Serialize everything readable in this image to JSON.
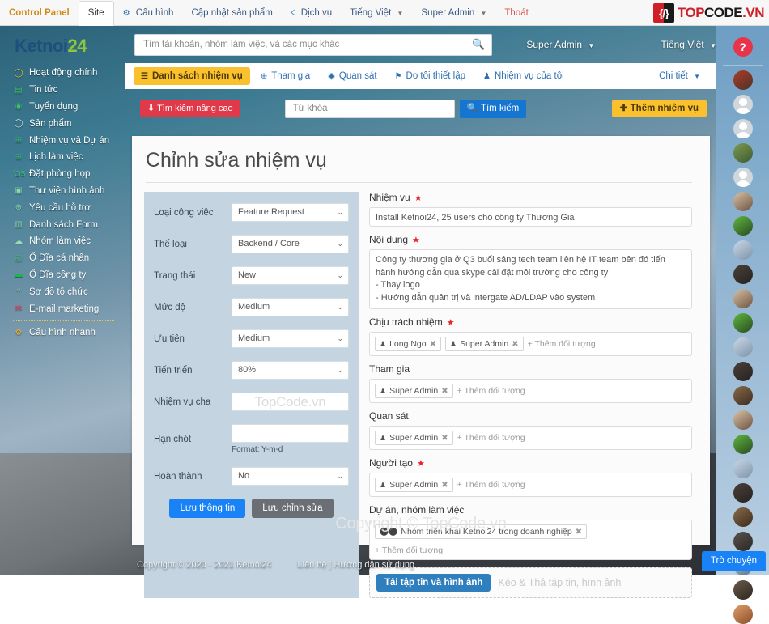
{
  "topbar": {
    "items": [
      {
        "label": "Control Panel",
        "style": "cp",
        "icon": null
      },
      {
        "label": "Site",
        "style": "site",
        "icon": null
      },
      {
        "label": "Cấu hình",
        "style": "nav",
        "icon": "gear-icon"
      },
      {
        "label": "Cập nhật sản phẩm",
        "style": "nav",
        "icon": null
      },
      {
        "label": "Dịch vụ",
        "style": "nav",
        "icon": "support-icon"
      },
      {
        "label": "Tiếng Việt",
        "style": "nav",
        "icon": null,
        "caret": true
      },
      {
        "label": "Super Admin",
        "style": "nav",
        "icon": null,
        "caret": true
      },
      {
        "label": "Thoát",
        "style": "exit",
        "icon": null
      }
    ],
    "logo": {
      "part1": "TOP",
      "part2": "CODE",
      "part3": ".VN",
      "glyph": "{/}"
    }
  },
  "sidebar": {
    "brand_1": "Ketnoi",
    "brand_2": "24",
    "items": [
      {
        "label": "Hoạt động chính",
        "icon": "circle-icon",
        "color": "#f0c419"
      },
      {
        "label": "Tin tức",
        "icon": "news-icon",
        "color": "#3fbf6f"
      },
      {
        "label": "Tuyển dụng",
        "icon": "user-circle-icon",
        "color": "#3fbf6f"
      },
      {
        "label": "Sản phẩm",
        "icon": "circle-icon",
        "color": "#cfe8d8"
      },
      {
        "label": "Nhiệm vụ và Dự án",
        "icon": "grid-icon",
        "color": "#3fbf6f"
      },
      {
        "label": "Lịch làm việc",
        "icon": "grid-icon",
        "color": "#3fbf6f"
      },
      {
        "label": "Đặt phòng họp",
        "icon": "calendar-icon",
        "color": "#3fbf6f"
      },
      {
        "label": "Thư viện hình ảnh",
        "icon": "image-icon",
        "color": "#8fd9ab"
      },
      {
        "label": "Yêu cầu hỗ trợ",
        "icon": "lifebuoy-icon",
        "color": "#8fd9ab"
      },
      {
        "label": "Danh sách Form",
        "icon": "form-icon",
        "color": "#8fd9ab"
      },
      {
        "label": "Nhóm làm việc",
        "icon": "group-icon",
        "color": "#9ed9b5"
      },
      {
        "label": "Ổ Đĩa cá nhân",
        "icon": "folder-open-icon",
        "color": "#3fbf6f"
      },
      {
        "label": "Ổ Đĩa công ty",
        "icon": "folder-icon",
        "color": "#1eb54a"
      },
      {
        "label": "Sơ đồ tổ chức",
        "icon": "sitemap-icon",
        "color": "#8fd9ab"
      },
      {
        "label": "E-mail marketing",
        "icon": "envelope-icon",
        "color": "#e8424f"
      }
    ],
    "footer_item": {
      "label": "Cấu hình nhanh",
      "icon": "gear-icon",
      "color": "#f0b429"
    }
  },
  "header": {
    "search_placeholder": "Tìm tài khoản, nhóm làm việc, và các mục khác",
    "search_value": "",
    "search_icon": "search-icon",
    "user": "Super Admin",
    "language": "Tiếng Việt"
  },
  "tabs": {
    "items": [
      {
        "label": "Danh sách nhiệm vụ",
        "icon": "list-icon",
        "active": true
      },
      {
        "label": "Tham gia",
        "icon": "plus-circle-icon",
        "active": false
      },
      {
        "label": "Quan sát",
        "icon": "eye-icon",
        "active": false
      },
      {
        "label": "Do tôi thiết lập",
        "icon": "pin-icon",
        "active": false
      },
      {
        "label": "Nhiệm vụ của tôi",
        "icon": "person-icon",
        "active": false
      }
    ],
    "detail": "Chi tiết"
  },
  "filter": {
    "advanced_label": "Tìm kiếm nâng cao",
    "advanced_icon": "arrow-down-icon",
    "keyword_placeholder": "Từ khóa",
    "keyword_value": "",
    "search_label": "Tìm kiếm",
    "search_icon": "search-icon",
    "add_label": "Thêm nhiệm vụ",
    "add_icon": "plus-icon"
  },
  "card": {
    "title": "Chỉnh sửa nhiệm vụ",
    "watermark": "Copyright © TopCode.vn",
    "left_form": {
      "rows": [
        {
          "label": "Loại công việc",
          "type": "select",
          "value": "Feature Request"
        },
        {
          "label": "Thể loại",
          "type": "select",
          "value": "Backend / Core"
        },
        {
          "label": "Trang thái",
          "type": "select",
          "value": "New"
        },
        {
          "label": "Mức độ",
          "type": "select",
          "value": "Medium"
        },
        {
          "label": "Ưu tiên",
          "type": "select",
          "value": "Medium"
        },
        {
          "label": "Tiến triển",
          "type": "select",
          "value": "80%"
        },
        {
          "label": "Nhiệm vụ cha",
          "type": "watermark",
          "value": "TopCode.vn"
        },
        {
          "label": "Hạn chót",
          "type": "text",
          "value": "",
          "hint": "Format: Y-m-d"
        },
        {
          "label": "Hoàn thành",
          "type": "select",
          "value": "No"
        }
      ],
      "save_label": "Lưu thông tin",
      "save_edit_label": "Lưu chỉnh sửa"
    },
    "right_form": {
      "task": {
        "label": "Nhiệm vụ",
        "required": true,
        "value": "Install Ketnoi24, 25 users cho công ty Thương Gia"
      },
      "content": {
        "label": "Nội dung",
        "required": true,
        "value": "Công ty thương gia ở Q3 buổi sáng tech team liên hệ IT team bên đó tiến hành hướng dẫn qua skype cài đặt môi trường cho công ty\n- Thay logo\n- Hướng dẫn quản trị và intergate AD/LDAP vào system"
      },
      "responsible": {
        "label": "Chịu trách nhiệm",
        "required": true,
        "tags": [
          "Long Ngo",
          "Super Admin"
        ],
        "add_label": "+ Thêm đối tượng"
      },
      "participants": {
        "label": "Tham gia",
        "required": false,
        "tags": [
          "Super Admin"
        ],
        "add_label": "+ Thêm đối tượng"
      },
      "observers": {
        "label": "Quan sát",
        "required": false,
        "tags": [
          "Super Admin"
        ],
        "add_label": "+ Thêm đối tượng"
      },
      "creator": {
        "label": "Người tạo",
        "required": true,
        "tags": [
          "Super Admin"
        ],
        "add_label": "+ Thêm đối tượng"
      },
      "project": {
        "label": "Dự án, nhóm làm việc",
        "required": false,
        "tags": [
          "Nhóm triển khai Ketnoi24 trong doanh nghiệp"
        ],
        "add_label": "+ Thêm đối tượng"
      },
      "upload": {
        "button_label": "Tải tập tin và hình ảnh",
        "drop_label": "Kéo & Thả tập tin, hình ảnh"
      }
    }
  },
  "rail": {
    "help_label": "?",
    "avatars": [
      {
        "type": "photo",
        "c1": "#b03a2a",
        "c2": "#4a3426"
      },
      {
        "type": "placeholder"
      },
      {
        "type": "placeholder"
      },
      {
        "type": "photo",
        "c1": "#7d9b4e",
        "c2": "#3e5a33"
      },
      {
        "type": "placeholder"
      },
      {
        "type": "photo",
        "c1": "#d8c3a8",
        "c2": "#6e5340"
      },
      {
        "type": "photo",
        "c1": "#5fb83f",
        "c2": "#2a4a22"
      },
      {
        "type": "photo",
        "c1": "#c9d8e8",
        "c2": "#7e93a8"
      },
      {
        "type": "photo",
        "c1": "#4a4038",
        "c2": "#262220"
      },
      {
        "type": "photo",
        "c1": "#d8c3a8",
        "c2": "#6e5340"
      },
      {
        "type": "photo",
        "c1": "#5fb83f",
        "c2": "#2a4a22"
      },
      {
        "type": "photo",
        "c1": "#c9d8e8",
        "c2": "#7e93a8"
      },
      {
        "type": "photo",
        "c1": "#4a4038",
        "c2": "#262220"
      },
      {
        "type": "photo",
        "c1": "#8a6a4a",
        "c2": "#3a2c1e"
      },
      {
        "type": "photo",
        "c1": "#d8c3a8",
        "c2": "#6e5340"
      },
      {
        "type": "photo",
        "c1": "#5fb83f",
        "c2": "#2a4a22"
      },
      {
        "type": "photo",
        "c1": "#c9d8e8",
        "c2": "#7e93a8"
      },
      {
        "type": "photo",
        "c1": "#4a4038",
        "c2": "#262220"
      },
      {
        "type": "photo",
        "c1": "#8a6a4a",
        "c2": "#3a2c1e"
      },
      {
        "type": "photo",
        "c1": "#5a5450",
        "c2": "#2a2622"
      },
      {
        "type": "photo",
        "c1": "#b8cede",
        "c2": "#5b7287"
      },
      {
        "type": "photo",
        "c1": "#6a5a4a",
        "c2": "#2e2620"
      },
      {
        "type": "photo",
        "c1": "#e0a06a",
        "c2": "#8a4e2a"
      }
    ]
  },
  "footer": {
    "copyright": "Copyright © 2020 - 2021 Ketnoi24",
    "links": "Liên hệ | Hướng dẫn sử dụng",
    "chat_label": "Trò chuyện"
  }
}
